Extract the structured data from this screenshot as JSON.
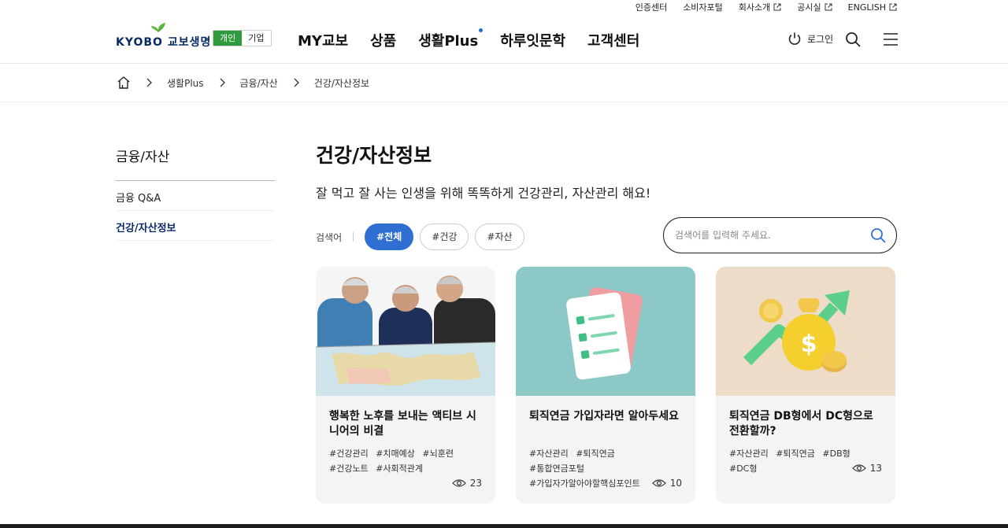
{
  "util_links": [
    "인증센터",
    "소비자포털",
    "회사소개",
    "공시실",
    "ENGLISH"
  ],
  "logo": {
    "text": "KYOBO 교보생명"
  },
  "segment": {
    "personal": "개인",
    "corporate": "기업"
  },
  "gnb": [
    "MY교보",
    "상품",
    "생활Plus",
    "하루잇문학",
    "고객센터"
  ],
  "header": {
    "login": "로그인"
  },
  "breadcrumb": [
    "생활Plus",
    "금융/자산",
    "건강/자산정보"
  ],
  "side": {
    "title": "금융/자산",
    "items": [
      "금융 Q&A",
      "건강/자산정보"
    ]
  },
  "main": {
    "title": "건강/자산정보",
    "subtitle": "잘 먹고 잘 사는 인생을 위해 똑똑하게 건강관리, 자산관리 해요!"
  },
  "filter": {
    "label": "검색어",
    "chips": [
      "#전체",
      "#건강",
      "#자산"
    ]
  },
  "search": {
    "placeholder": "검색어를 입력해 주세요."
  },
  "cards": [
    {
      "title": "행복한 노후를 보내는 액티브 시니어의 비결",
      "tags": [
        "#건강관리",
        "#치매예상",
        "#뇌훈련",
        "#건강노트",
        "#사회적관계"
      ],
      "views": "23"
    },
    {
      "title": "퇴직연금 가입자라면 알아두세요",
      "tags": [
        "#자산관리",
        "#퇴직연금",
        "#통합연금포털",
        "#가입자가알아야할핵심포인트"
      ],
      "views": "10"
    },
    {
      "title": "퇴직연금 DB형에서 DC형으로 전환할까?",
      "tags": [
        "#자산관리",
        "#퇴직연금",
        "#DB형",
        "#DC형"
      ],
      "views": "13"
    }
  ],
  "colors": {
    "brand_navy": "#0a2a66",
    "brand_green": "#2e9b3f",
    "accent_blue": "#2e6fd1"
  }
}
